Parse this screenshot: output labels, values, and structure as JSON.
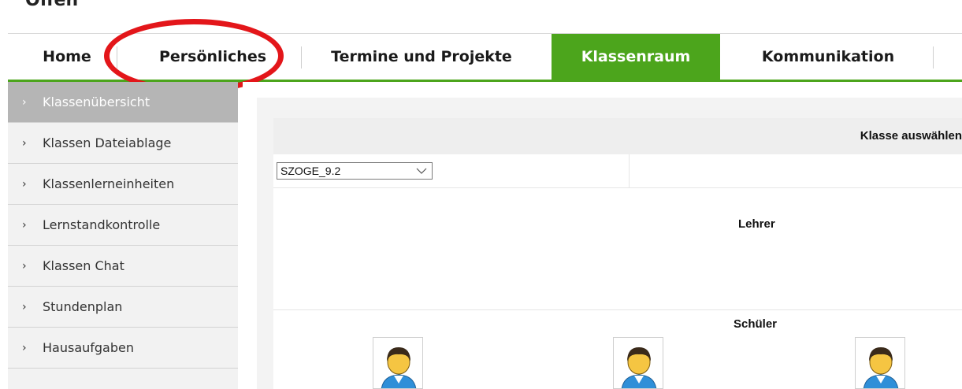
{
  "page": {
    "top_title": "Offen"
  },
  "topnav": {
    "tabs": [
      {
        "label": "Home",
        "active": false
      },
      {
        "label": "Persönliches",
        "active": false,
        "highlighted": true
      },
      {
        "label": "Termine und Projekte",
        "active": false
      },
      {
        "label": "Klassenraum",
        "active": true
      },
      {
        "label": "Kommunikation",
        "active": false
      }
    ]
  },
  "sidebar": {
    "items": [
      {
        "label": "Klassenübersicht",
        "active": true
      },
      {
        "label": "Klassen Dateiablage",
        "active": false
      },
      {
        "label": "Klassenlerneinheiten",
        "active": false
      },
      {
        "label": "Lernstandkontrolle",
        "active": false
      },
      {
        "label": "Klassen Chat",
        "active": false
      },
      {
        "label": "Stundenplan",
        "active": false
      },
      {
        "label": "Hausaufgaben",
        "active": false
      }
    ]
  },
  "main": {
    "klasse_label": "Klasse auswählen",
    "class_select": {
      "value": "SZOGE_9.2"
    },
    "lehrer_label": "Lehrer",
    "schueler_label": "Schüler"
  },
  "colors": {
    "accent_green": "#4ca51c",
    "highlight_red": "#e3161a",
    "sidebar_active": "#b5b5b5"
  },
  "icons": {
    "sidebar_item": "chevron-right-icon",
    "select": "chevron-down-icon",
    "student": "person-avatar-icon"
  }
}
